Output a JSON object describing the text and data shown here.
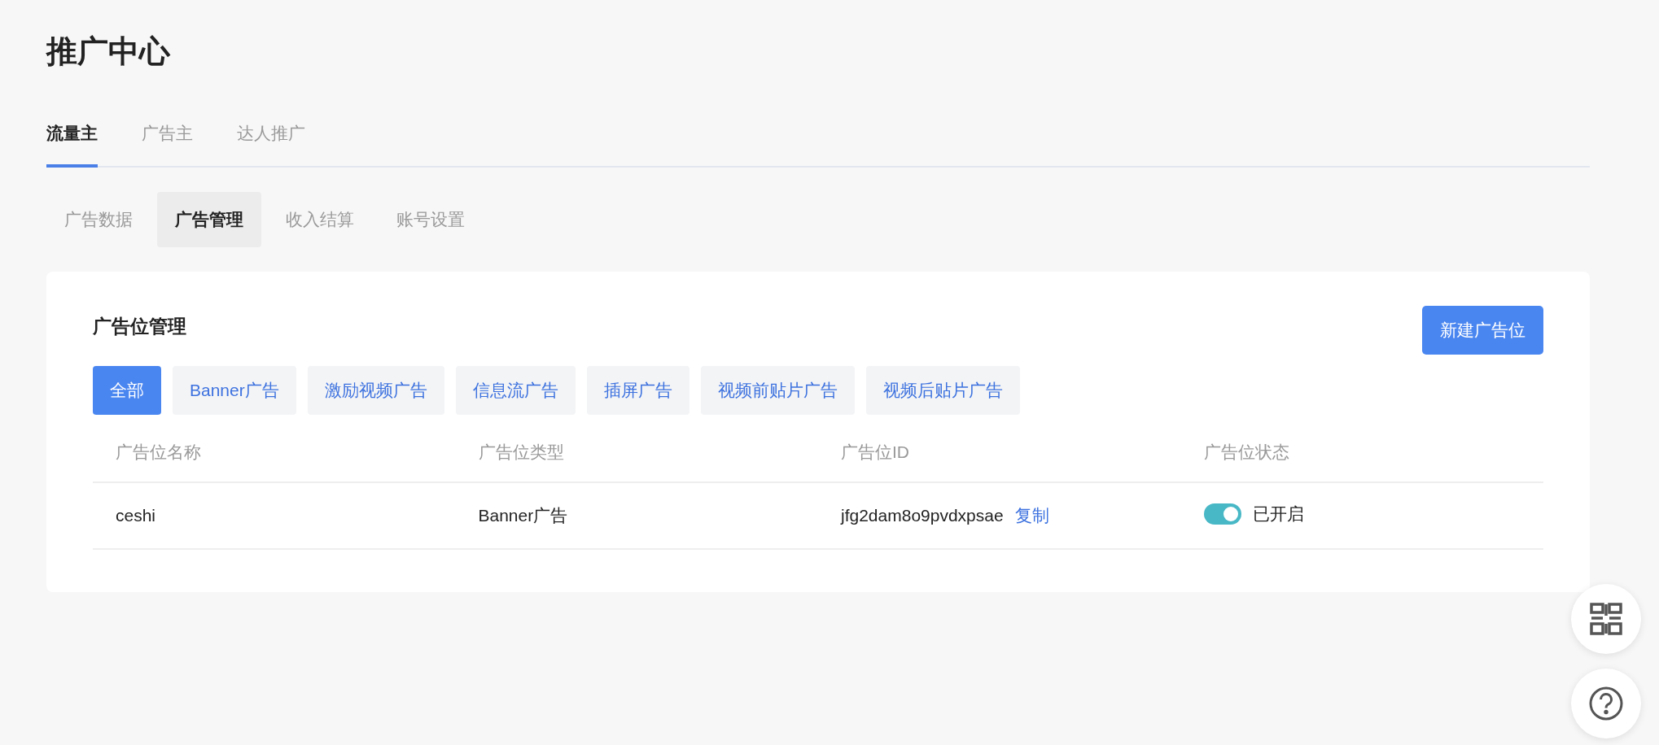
{
  "page_title": "推广中心",
  "tabs": [
    {
      "label": "流量主",
      "selected": true
    },
    {
      "label": "广告主",
      "selected": false
    },
    {
      "label": "达人推广",
      "selected": false
    }
  ],
  "sub_tabs": [
    {
      "label": "广告数据",
      "selected": false
    },
    {
      "label": "广告管理",
      "selected": true
    },
    {
      "label": "收入结算",
      "selected": false
    },
    {
      "label": "账号设置",
      "selected": false
    }
  ],
  "card": {
    "title": "广告位管理",
    "new_button": "新建广告位",
    "filters": [
      {
        "label": "全部",
        "selected": true
      },
      {
        "label": "Banner广告",
        "selected": false
      },
      {
        "label": "激励视频广告",
        "selected": false
      },
      {
        "label": "信息流广告",
        "selected": false
      },
      {
        "label": "插屏广告",
        "selected": false
      },
      {
        "label": "视频前贴片广告",
        "selected": false
      },
      {
        "label": "视频后贴片广告",
        "selected": false
      }
    ],
    "table": {
      "columns": [
        "广告位名称",
        "广告位类型",
        "广告位ID",
        "广告位状态"
      ],
      "rows": [
        {
          "name": "ceshi",
          "type": "Banner广告",
          "id": "jfg2dam8o9pvdxpsae",
          "copy_link": "复制",
          "on": true,
          "status": "已开启"
        }
      ]
    }
  }
}
